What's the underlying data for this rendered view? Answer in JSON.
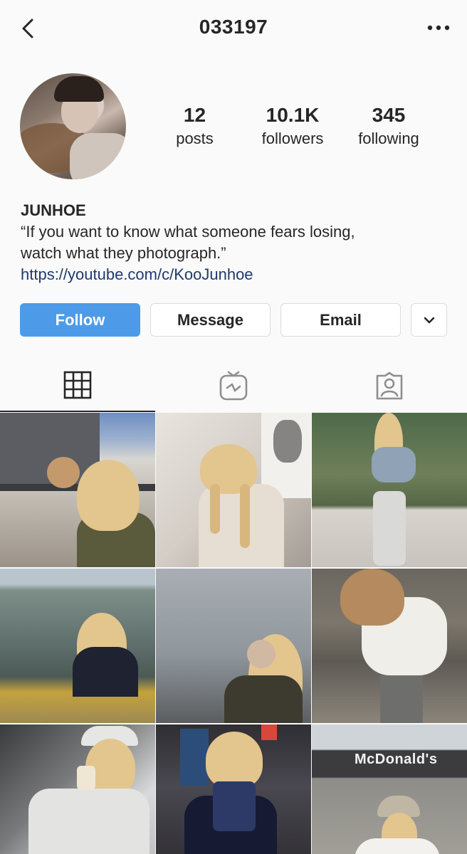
{
  "header": {
    "username": "033197"
  },
  "profile": {
    "stats": {
      "posts_count": "12",
      "posts_label": "posts",
      "followers_count": "10.1K",
      "followers_label": "followers",
      "following_count": "345",
      "following_label": "following"
    },
    "name": "JUNHOE",
    "bio_line1": "“If you want to know what someone fears losing,",
    "bio_line2": "watch what they photograph.”",
    "link": "https://youtube.com/c/KooJunhoe"
  },
  "actions": {
    "follow_label": "Follow",
    "message_label": "Message",
    "email_label": "Email"
  },
  "tabs": [
    "grid-icon",
    "igtv-icon",
    "tagged-icon"
  ],
  "posts": [
    {
      "icon": "photo-building-cat"
    },
    {
      "icon": "photo-braids-mural"
    },
    {
      "icon": "photo-museum-painting"
    },
    {
      "icon": "photo-boat-sea"
    },
    {
      "icon": "photo-sky-dusk"
    },
    {
      "icon": "photo-street-sweatshirt"
    },
    {
      "icon": "photo-car-drink"
    },
    {
      "icon": "photo-cinema-popcorn"
    },
    {
      "icon": "photo-mcdonalds-sign"
    }
  ],
  "photo_text": {
    "mcdonalds_sign": "McDonald's"
  }
}
